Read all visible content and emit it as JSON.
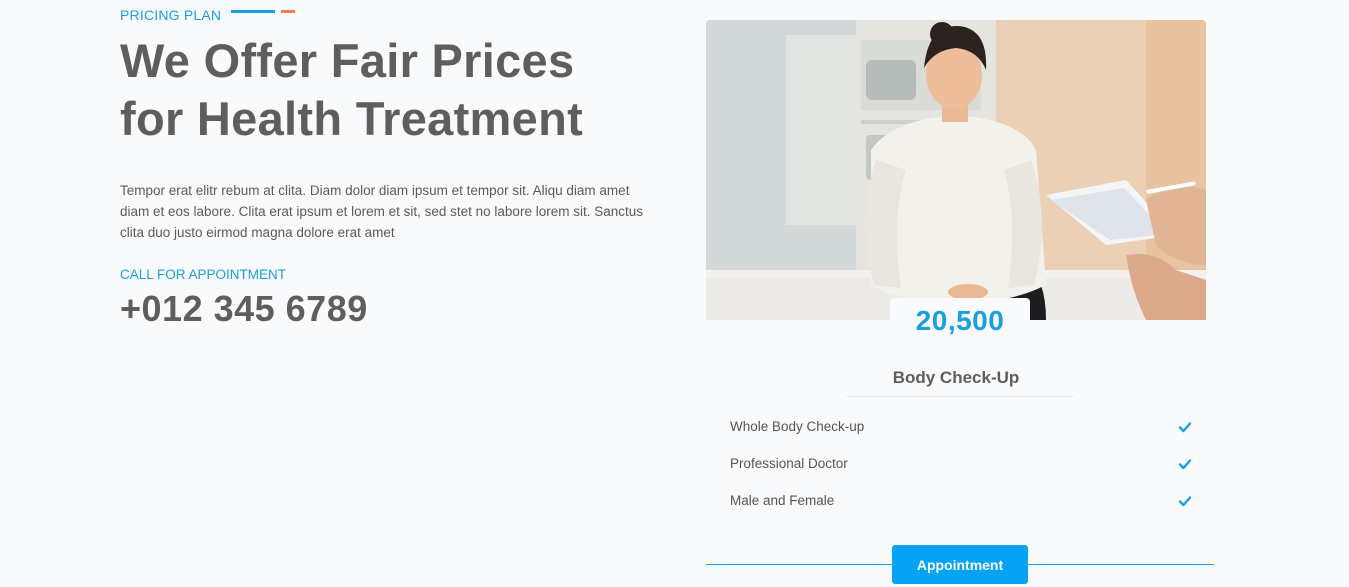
{
  "section": {
    "subtitle": "PRICING PLAN",
    "headline_line1": "We Offer Fair Prices",
    "headline_line2": "for Health Treatment",
    "description": "Tempor erat elitr rebum at clita. Diam dolor diam ipsum et tempor sit. Aliqu diam amet diam et eos labore. Clita erat ipsum et lorem et sit, sed stet no labore lorem sit. Sanctus clita duo justo eirmod magna dolore erat amet",
    "call_label": "CALL FOR APPOINTMENT",
    "phone": "+012 345 6789"
  },
  "plan": {
    "price": "20,500",
    "title": "Body Check-Up",
    "features": [
      {
        "label": "Whole Body Check-up",
        "icon": "check-icon"
      },
      {
        "label": "Professional Doctor",
        "icon": "check-icon"
      },
      {
        "label": "Male and Female",
        "icon": "check-icon"
      }
    ],
    "button_label": "Appointment"
  },
  "colors": {
    "accent": "#1a9fe0",
    "accent_secondary": "#f57e57",
    "button": "#06a3f5",
    "heading": "#5e5e5e"
  }
}
